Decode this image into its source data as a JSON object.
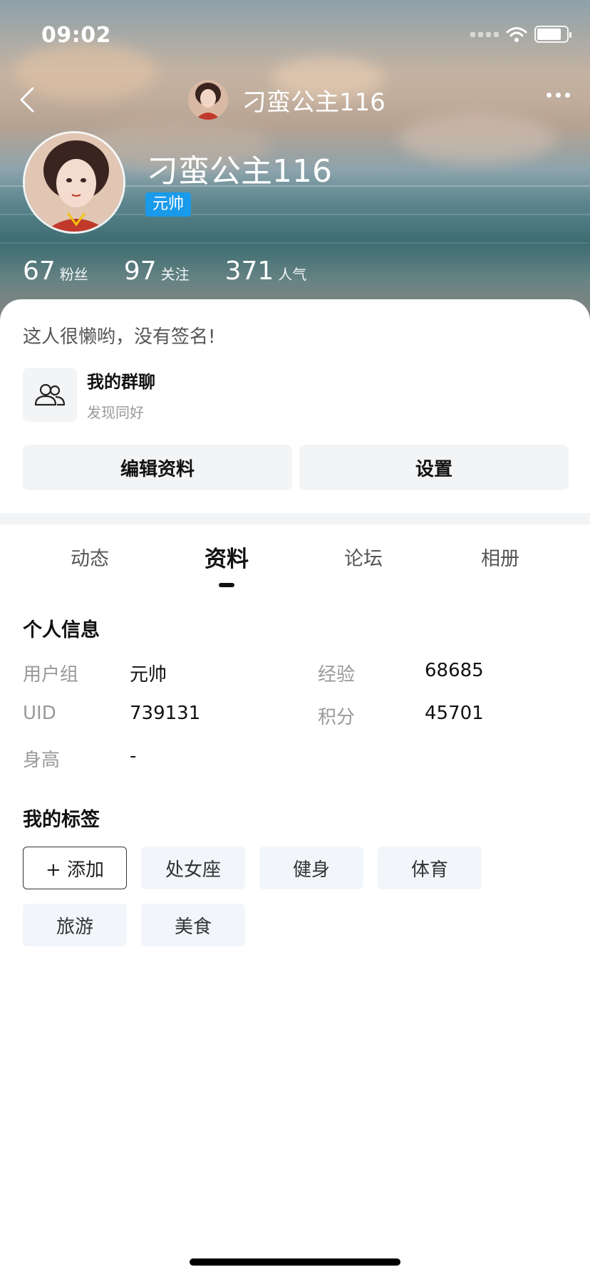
{
  "status_bar": {
    "time": "09:02"
  },
  "nav": {
    "title": "刁蛮公主116"
  },
  "profile": {
    "name": "刁蛮公主116",
    "rank": "元帅",
    "stats": [
      {
        "value": "67",
        "label": "粉丝"
      },
      {
        "value": "97",
        "label": "关注"
      },
      {
        "value": "371",
        "label": "人气"
      }
    ],
    "signature": "这人很懒哟，没有签名!"
  },
  "group_chat": {
    "title": "我的群聊",
    "subtitle": "发现同好"
  },
  "actions": {
    "edit_label": "编辑资料",
    "settings_label": "设置"
  },
  "tabs": [
    {
      "label": "动态",
      "active": false
    },
    {
      "label": "资料",
      "active": true
    },
    {
      "label": "论坛",
      "active": false
    },
    {
      "label": "相册",
      "active": false
    }
  ],
  "personal_info": {
    "title": "个人信息",
    "user_group_label": "用户组",
    "user_group_value": "元帅",
    "exp_label": "经验",
    "exp_value": "68685",
    "uid_label": "UID",
    "uid_value": "739131",
    "points_label": "积分",
    "points_value": "45701",
    "height_label": "身高",
    "height_value": "-"
  },
  "tags": {
    "title": "我的标签",
    "add_label": "+ 添加",
    "items": [
      "处女座",
      "健身",
      "体育",
      "旅游",
      "美食"
    ]
  },
  "colors": {
    "badge": "#1a9aea",
    "tag_bg": "#f2f6fb",
    "button_bg": "#f3f4f6"
  }
}
